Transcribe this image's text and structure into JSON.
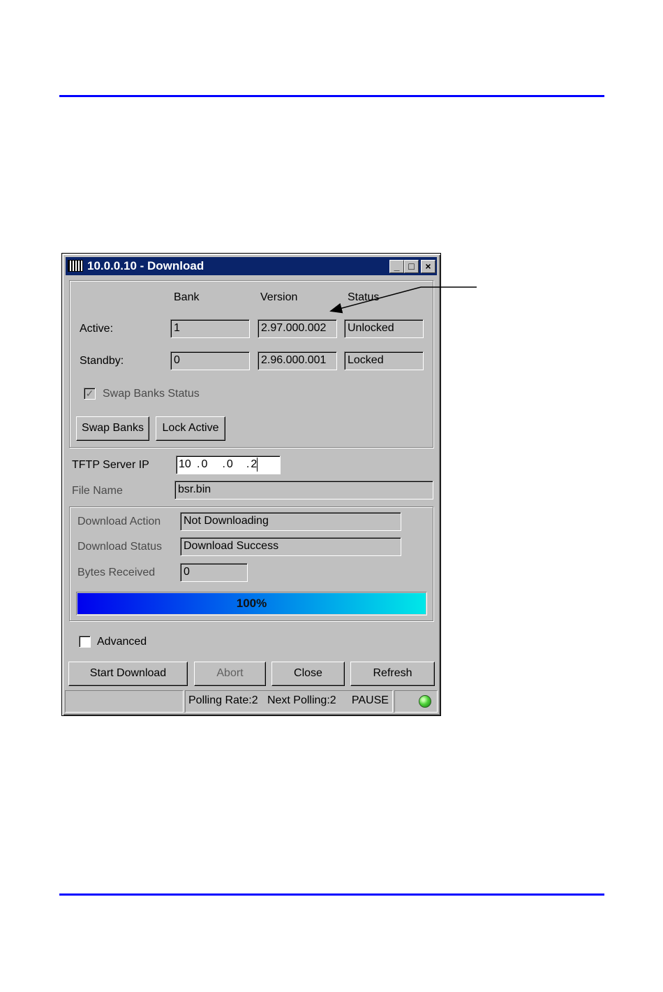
{
  "window": {
    "title": "10.0.0.10 - Download",
    "controls": {
      "minimize": "_",
      "maximize": "□",
      "close": "×"
    }
  },
  "banks": {
    "headers": {
      "bank": "Bank",
      "version": "Version",
      "status": "Status"
    },
    "active": {
      "label": "Active:",
      "bank": "1",
      "version": "2.97.000.002",
      "status": "Unlocked"
    },
    "standby": {
      "label": "Standby:",
      "bank": "0",
      "version": "2.96.000.001",
      "status": "Locked"
    },
    "swap_status": {
      "label": "Swap Banks Status",
      "checked": true
    },
    "buttons": {
      "swap": "Swap Banks",
      "lock": "Lock Active"
    }
  },
  "tftp": {
    "label": "TFTP Server IP",
    "octets": [
      "10",
      "0",
      "0",
      "2"
    ],
    "dot": "."
  },
  "file": {
    "label": "File Name",
    "value": "bsr.bin"
  },
  "download": {
    "action_label": "Download Action",
    "action_value": "Not Downloading",
    "status_label": "Download Status",
    "status_value": "Download Success",
    "bytes_label": "Bytes Received",
    "bytes_value": "0",
    "progress_percent": 100,
    "progress_text": "100%"
  },
  "advanced": {
    "label": "Advanced",
    "checked": false
  },
  "buttons": {
    "start": "Start Download",
    "abort": "Abort",
    "close": "Close",
    "refresh": "Refresh"
  },
  "statusbar": {
    "polling": "Polling Rate:2   Next Polling:2     PAUSE",
    "indicator": "green-led-icon"
  },
  "colors": {
    "rule": "#0000ff",
    "titlebar": "#0a246a",
    "progress_start": "#0000ee",
    "progress_end": "#00e8e8"
  }
}
